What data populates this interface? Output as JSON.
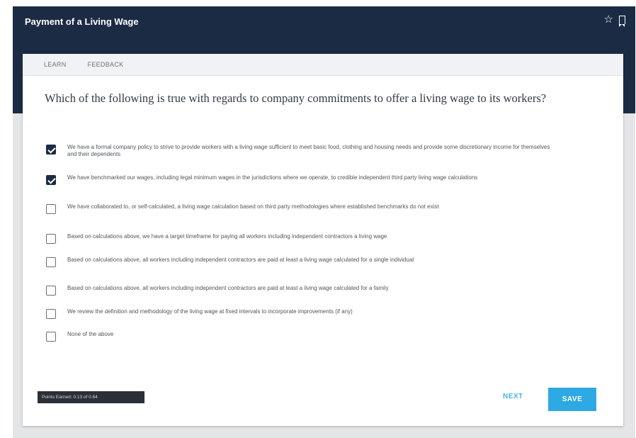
{
  "header": {
    "title": "Payment of a Living Wage",
    "icons": [
      "star-icon",
      "bookmark-icon"
    ]
  },
  "tabs": [
    {
      "label": "LEARN"
    },
    {
      "label": "FEEDBACK"
    }
  ],
  "question": "Which of the following is true with regards to company commitments to offer a living wage to its workers?",
  "options": [
    {
      "label": "We have a formal company policy to strive to provide workers with a living wage sufficient to meet basic food, clothing and housing needs and provide some discretionary income for themselves and their dependents",
      "checked": true
    },
    {
      "label": "We have benchmarked our wages, including legal minimum wages in the jurisdictions where we operate, to credible independent third party living wage calculations",
      "checked": true
    },
    {
      "label": "We have collaborated to, or self-calculated, a living wage calculation based on third party methodologies where established benchmarks do not exist",
      "checked": false
    },
    {
      "label": "Based on calculations above, we have a target timeframe for paying all workers including independent contractors a living wage",
      "checked": false
    },
    {
      "label": "Based on calculations above, all workers including independent contractors are paid at least a living wage calculated for a single individual",
      "checked": false
    },
    {
      "label": "Based on calculations above, all workers including independent contractors are paid at least a living wage calculated for a family",
      "checked": false
    },
    {
      "label": "We review the definition and methodology of the living wage at fixed intervals to incorporate improvements (if any)",
      "checked": false
    },
    {
      "label": "None of the above",
      "checked": false
    }
  ],
  "footer": {
    "points_badge": "Points Earned: 0.13 of 0.64",
    "next_label": "NEXT",
    "save_label": "SAVE"
  },
  "colors": {
    "header_bg": "#1c2b44",
    "accent": "#2fa9e3",
    "checkbox_checked": "#1c2b44"
  }
}
